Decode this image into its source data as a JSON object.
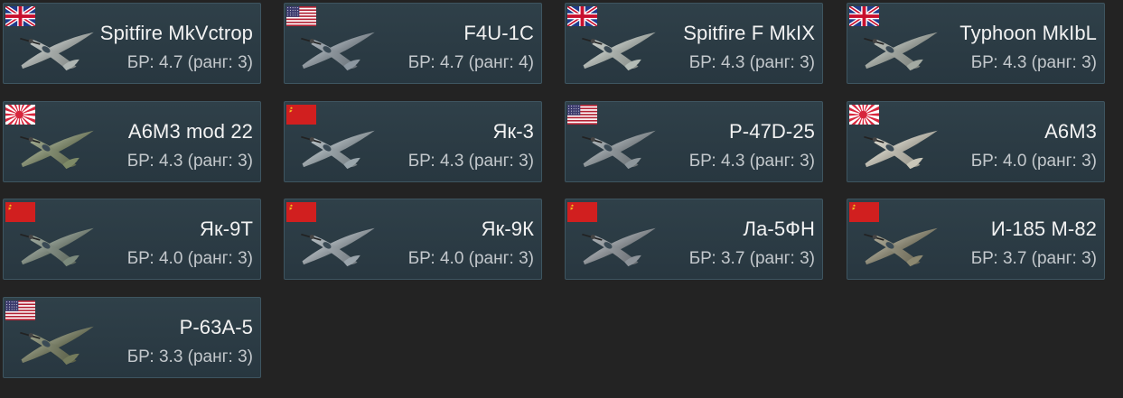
{
  "vehicles": [
    {
      "name": "Spitfire MkVctrop",
      "br": "БР: 4.7 (ранг: 3)",
      "flag": "uk-flag-icon",
      "plane_color": "#aeb5b2"
    },
    {
      "name": "F4U-1C",
      "br": "БР: 4.7 (ранг: 4)",
      "flag": "usa-flag-icon",
      "plane_color": "#8c97a0"
    },
    {
      "name": "Spitfire F MkIX",
      "br": "БР: 4.3 (ранг: 3)",
      "flag": "uk-flag-icon",
      "plane_color": "#b4bcb6"
    },
    {
      "name": "Typhoon MkIbL",
      "br": "БР: 4.3 (ранг: 3)",
      "flag": "uk-flag-icon",
      "plane_color": "#a3aaa2"
    },
    {
      "name": "A6M3 mod 22",
      "br": "БР: 4.3 (ранг: 3)",
      "flag": "japan-flag-icon",
      "plane_color": "#7e8a67"
    },
    {
      "name": "Як-3",
      "br": "БР: 4.3 (ранг: 3)",
      "flag": "ussr-flag-icon",
      "plane_color": "#9aa6ac"
    },
    {
      "name": "P-47D-25",
      "br": "БР: 4.3 (ранг: 3)",
      "flag": "usa-flag-icon",
      "plane_color": "#8d969b"
    },
    {
      "name": "A6M3",
      "br": "БР: 4.0 (ранг: 3)",
      "flag": "japan-flag-icon",
      "plane_color": "#c9c6b8"
    },
    {
      "name": "Як-9Т",
      "br": "БР: 4.0 (ранг: 3)",
      "flag": "ussr-flag-icon",
      "plane_color": "#7c8a7c"
    },
    {
      "name": "Як-9К",
      "br": "БР: 4.0 (ранг: 3)",
      "flag": "ussr-flag-icon",
      "plane_color": "#9aa4ab"
    },
    {
      "name": "Ла-5ФН",
      "br": "БР: 3.7 (ранг: 3)",
      "flag": "ussr-flag-icon",
      "plane_color": "#8d9399"
    },
    {
      "name": "И-185 М-82",
      "br": "БР: 3.7 (ранг: 3)",
      "flag": "ussr-flag-icon",
      "plane_color": "#8c8870"
    },
    {
      "name": "P-63A-5",
      "br": "БР: 3.3 (ранг: 3)",
      "flag": "usa-flag-icon",
      "plane_color": "#747b5c"
    }
  ]
}
